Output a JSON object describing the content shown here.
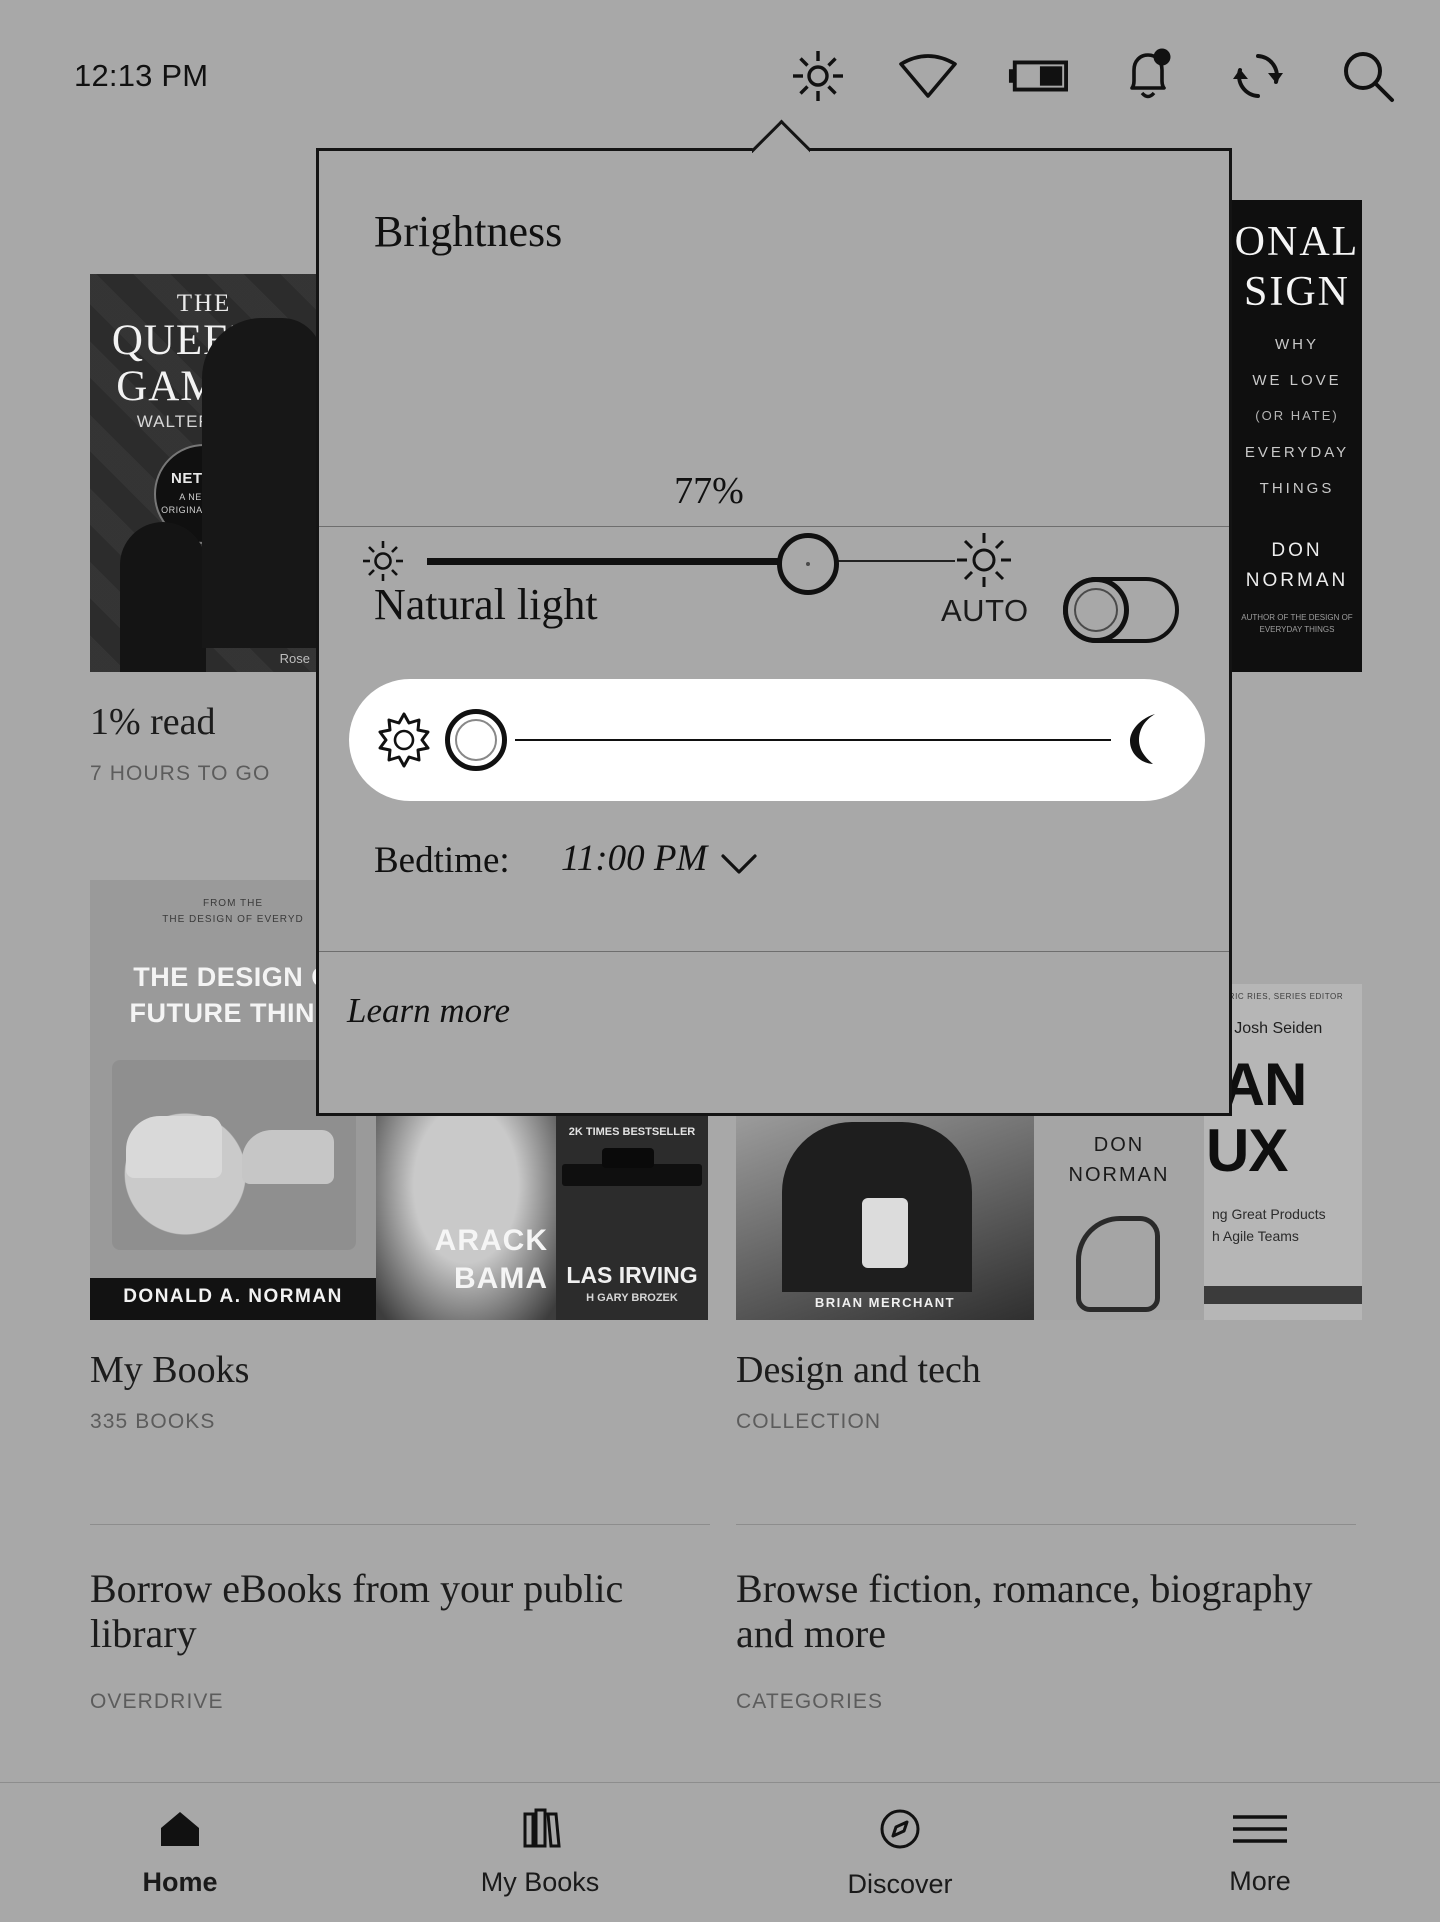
{
  "device": {
    "screen_background": "#a8a8a8",
    "accent": "#111111"
  },
  "statusbar": {
    "time": "12:13 PM",
    "icons": [
      {
        "name": "brightness-icon",
        "label": "Brightness"
      },
      {
        "name": "wifi-icon",
        "label": "Wi-Fi"
      },
      {
        "name": "battery-icon",
        "label": "Battery"
      },
      {
        "name": "notifications-icon",
        "label": "Notifications"
      },
      {
        "name": "sync-icon",
        "label": "Sync"
      },
      {
        "name": "search-icon",
        "label": "Search"
      }
    ]
  },
  "panel": {
    "brightness_heading": "Brightness",
    "brightness_percent": "77%",
    "brightness_value": 77,
    "natural_light_heading": "Natural light",
    "auto_label": "AUTO",
    "auto_on": false,
    "natural_light_value": 2,
    "bedtime_label": "Bedtime:",
    "bedtime_value": "11:00 PM",
    "learn_more": "Learn more"
  },
  "library": {
    "row1": {
      "book1": {
        "line1": "THE",
        "line2": "QUEEN'S",
        "line3": "GAMBIT",
        "author": "WALTER TEVIS",
        "badge1": "NETFLIX",
        "badge2": "A NETFLIX",
        "badge3": "ORIGINAL SERIES",
        "credit": "Rose",
        "progress": "1% read",
        "remaining": "7 HOURS TO GO"
      },
      "book2": {
        "line1": "ONAL",
        "line2": "SIGN",
        "line3": "WHY",
        "line4": "WE LOVE",
        "line5": "(OR HATE)",
        "line6": "EVERYDAY",
        "line7": "THINGS",
        "author": "DON",
        "author2": "NORMAN",
        "footer": "AUTHOR OF THE DESIGN OF EVERYDAY THINGS"
      }
    },
    "row2": {
      "book1": {
        "top1": "FROM THE",
        "top2": "THE DESIGN OF EVERYD",
        "line1": "THE DESIGN O",
        "line2": "FUTURE THING",
        "author": "DONALD A. NORMAN"
      },
      "book2": {
        "line1": "ARACK",
        "line2": "BAMA"
      },
      "book3": {
        "line1": "2K TIMES BESTSELLER",
        "line2": "LAS IRVING",
        "line3": "H GARY BROZEK"
      },
      "book4": {
        "author": "BRIAN MERCHANT"
      },
      "book5": {
        "line1": "DON",
        "line2": "NORMAN"
      },
      "book6": {
        "top": "ERIC RIES, SERIES EDITOR",
        "byline": "nd Josh Seiden",
        "line1": ".AN",
        "line2": "UX",
        "sub1": "ng Great Products",
        "sub2": "h Agile Teams"
      },
      "collection1": {
        "title": "My Books",
        "sub": "335 BOOKS"
      },
      "collection2": {
        "title": "Design and tech",
        "sub": "COLLECTION"
      }
    },
    "promos": [
      {
        "title": "Borrow eBooks from your public library",
        "sub": "OVERDRIVE"
      },
      {
        "title": "Browse fiction, romance, biography and more",
        "sub": "CATEGORIES"
      }
    ]
  },
  "bottomnav": {
    "items": [
      {
        "label": "Home",
        "icon": "home-icon",
        "active": true
      },
      {
        "label": "My Books",
        "icon": "books-icon",
        "active": false
      },
      {
        "label": "Discover",
        "icon": "compass-icon",
        "active": false
      },
      {
        "label": "More",
        "icon": "menu-icon",
        "active": false
      }
    ]
  }
}
